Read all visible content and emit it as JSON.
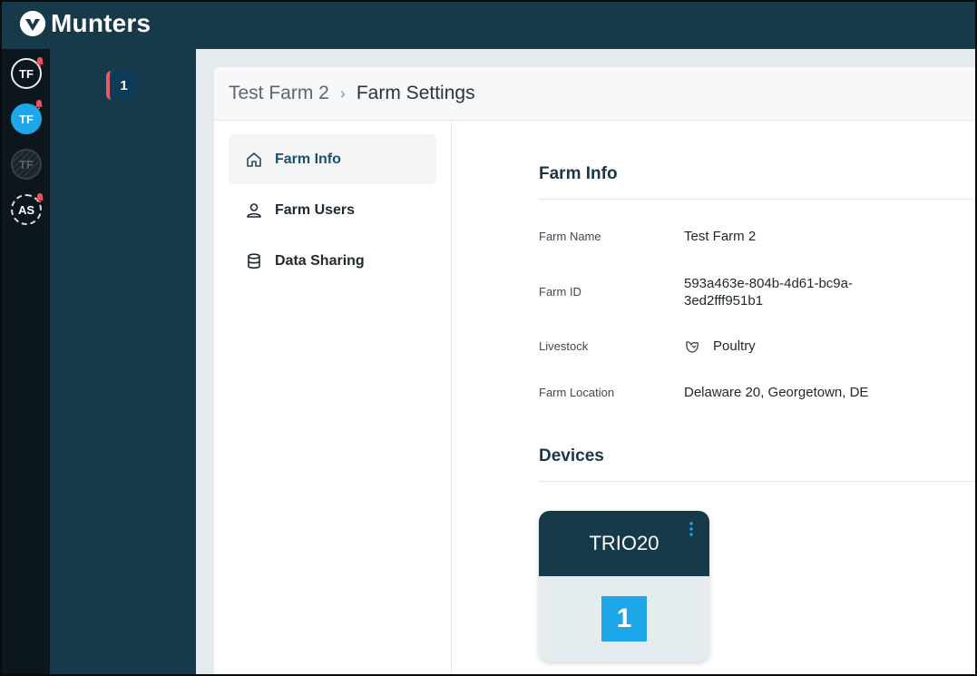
{
  "brand": {
    "name": "Munters"
  },
  "rail": {
    "avatars": [
      {
        "initials": "TF",
        "notification": true
      },
      {
        "initials": "TF",
        "notification": true
      },
      {
        "initials": "TF",
        "notification": false
      },
      {
        "initials": "AS",
        "notification": true
      }
    ]
  },
  "panel": {
    "farm_badge": "1"
  },
  "breadcrumb": {
    "farm": "Test Farm 2",
    "separator": "›",
    "page": "Farm Settings"
  },
  "nav": {
    "items": [
      {
        "label": "Farm Info",
        "icon": "home-icon",
        "active": true
      },
      {
        "label": "Farm Users",
        "icon": "user-icon",
        "active": false
      },
      {
        "label": "Data Sharing",
        "icon": "database-icon",
        "active": false
      }
    ]
  },
  "farm_info": {
    "title": "Farm Info",
    "fields": {
      "name": {
        "label": "Farm Name",
        "value": "Test Farm 2"
      },
      "id": {
        "label": "Farm ID",
        "value_line1": "593a463e-804b-4d61-bc9a-",
        "value_line2": "3ed2fff951b1"
      },
      "livestock": {
        "label": "Livestock",
        "value": "Poultry",
        "icon": "chicken-icon"
      },
      "location": {
        "label": "Farm Location",
        "value": "Delaware 20, Georgetown, DE"
      }
    }
  },
  "devices": {
    "title": "Devices",
    "items": [
      {
        "name": "TRIO20",
        "number": "1"
      }
    ]
  },
  "colors": {
    "brand_dark": "#173a4b",
    "accent_blue": "#1da6e8",
    "notification_red": "#f0505e"
  }
}
